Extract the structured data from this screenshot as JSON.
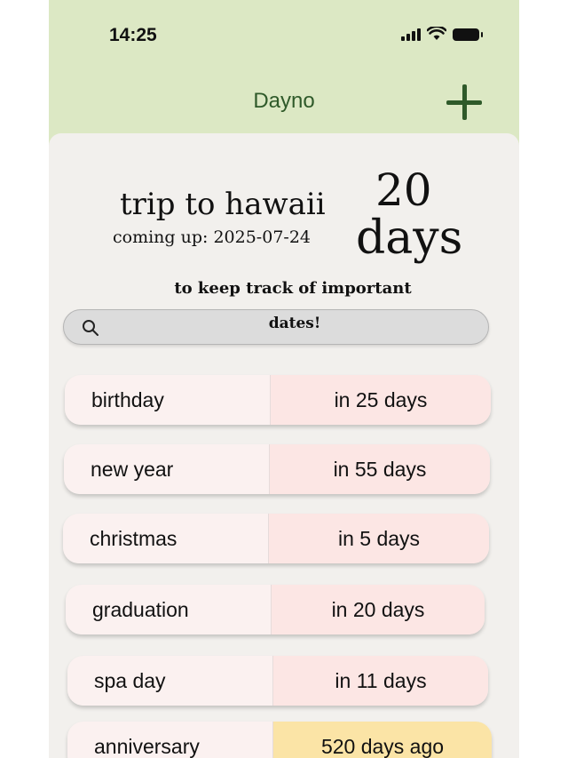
{
  "status_bar": {
    "time": "14:25"
  },
  "header": {
    "title": "Dayno",
    "add_icon": "plus-icon"
  },
  "featured": {
    "name": "trip to hawaii",
    "date_line": "coming up: 2025-07-24",
    "count": "20",
    "unit": "days"
  },
  "tagline": {
    "line1": "to keep track of important",
    "line2": "dates!"
  },
  "search": {
    "icon": "search-icon"
  },
  "colors": {
    "header_bg": "#dce8c4",
    "accent": "#2f5a2a",
    "upcoming_bg": "#fce6e4",
    "past_bg": "#fbe4a6"
  },
  "events": [
    {
      "name": "birthday",
      "countdown": "in 25 days",
      "status": "upcoming"
    },
    {
      "name": "new year",
      "countdown": "in 55 days",
      "status": "upcoming"
    },
    {
      "name": "christmas",
      "countdown": "in 5 days",
      "status": "upcoming"
    },
    {
      "name": "graduation",
      "countdown": "in 20 days",
      "status": "upcoming"
    },
    {
      "name": "spa day",
      "countdown": "in 11 days",
      "status": "upcoming"
    },
    {
      "name": "anniversary",
      "countdown": "520 days ago",
      "status": "past"
    }
  ]
}
